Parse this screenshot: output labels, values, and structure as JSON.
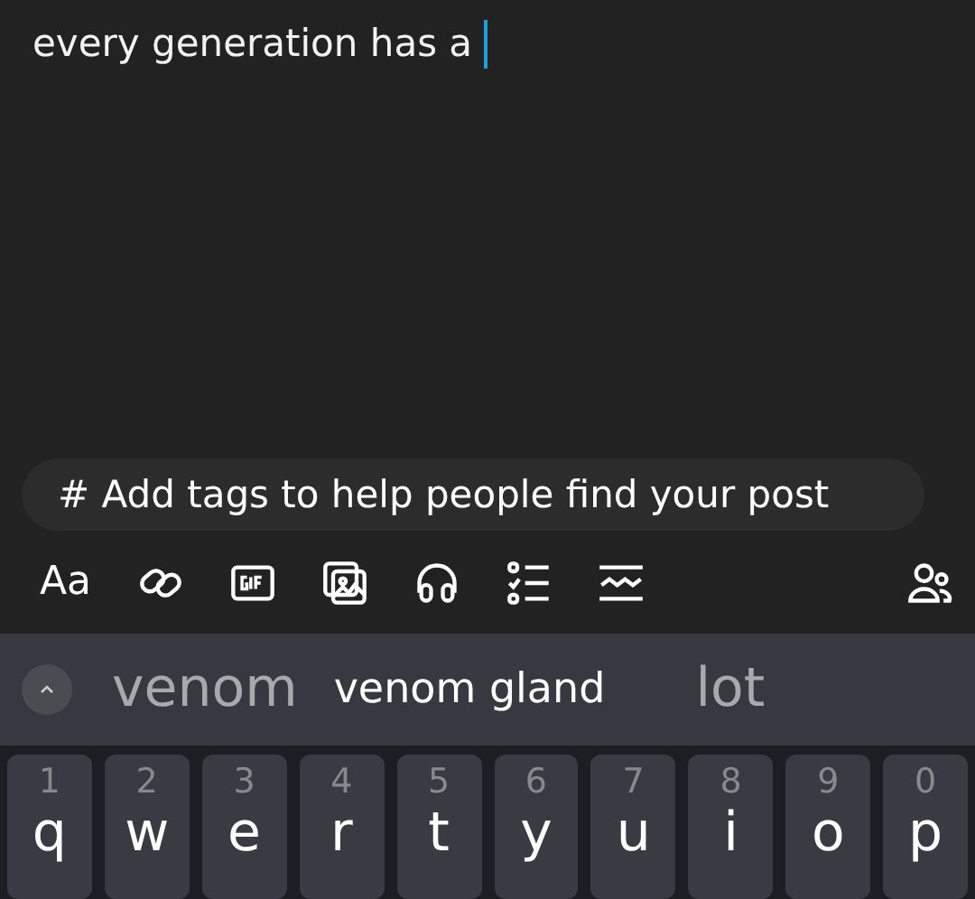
{
  "post": {
    "text": "every generation has a"
  },
  "tags": {
    "placeholder": "# Add tags to help people find your post"
  },
  "toolbar": {
    "text_style": "Aa"
  },
  "suggestions": [
    {
      "text": "venom",
      "selected": false
    },
    {
      "text": "venom gland",
      "selected": true
    },
    {
      "text": "lot",
      "selected": false
    }
  ],
  "keys": [
    {
      "digit": "1",
      "letter": "q"
    },
    {
      "digit": "2",
      "letter": "w"
    },
    {
      "digit": "3",
      "letter": "e"
    },
    {
      "digit": "4",
      "letter": "r"
    },
    {
      "digit": "5",
      "letter": "t"
    },
    {
      "digit": "6",
      "letter": "y"
    },
    {
      "digit": "7",
      "letter": "u"
    },
    {
      "digit": "8",
      "letter": "i"
    },
    {
      "digit": "9",
      "letter": "o"
    },
    {
      "digit": "0",
      "letter": "p"
    }
  ]
}
